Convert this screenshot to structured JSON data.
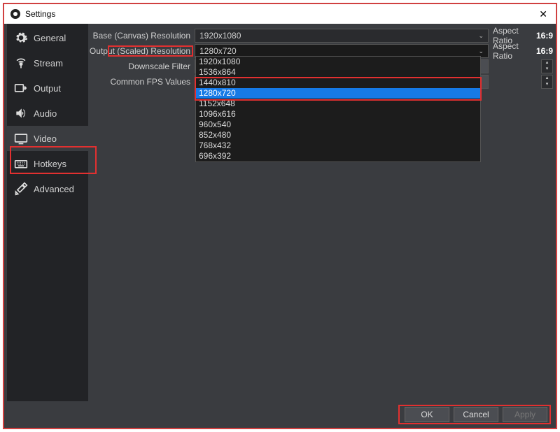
{
  "window": {
    "title": "Settings",
    "close": "✕"
  },
  "sidebar": {
    "items": [
      {
        "label": "General"
      },
      {
        "label": "Stream"
      },
      {
        "label": "Output"
      },
      {
        "label": "Audio"
      },
      {
        "label": "Video"
      },
      {
        "label": "Hotkeys"
      },
      {
        "label": "Advanced"
      }
    ]
  },
  "form": {
    "base_label": "Base (Canvas) Resolution",
    "base_value": "1920x1080",
    "output_label": "Output (Scaled) Resolution",
    "output_value": "1280x720",
    "downscale_label": "Downscale Filter",
    "fps_label": "Common FPS Values",
    "aspect_label": "Aspect Ratio",
    "aspect_value": "16:9"
  },
  "dropdown": {
    "options": [
      "1920x1080",
      "1536x864",
      "1440x810",
      "1280x720",
      "1152x648",
      "1096x616",
      "960x540",
      "852x480",
      "768x432",
      "696x392"
    ],
    "selected_index": 3
  },
  "footer": {
    "ok": "OK",
    "cancel": "Cancel",
    "apply": "Apply"
  }
}
